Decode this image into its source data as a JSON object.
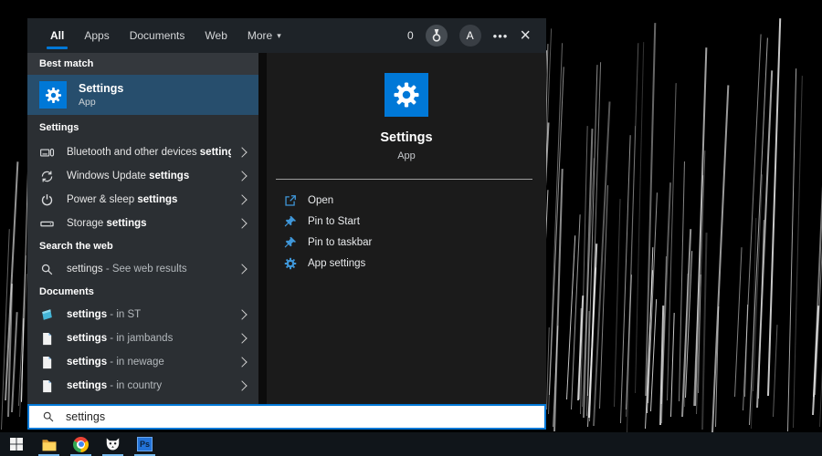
{
  "colors": {
    "accent": "#0078d7",
    "best_match_highlight": "#274e6d",
    "action_icon_blue": "#3f97d9"
  },
  "topbar": {
    "tabs": [
      {
        "label": "All",
        "active": true
      },
      {
        "label": "Apps",
        "active": false
      },
      {
        "label": "Documents",
        "active": false
      },
      {
        "label": "Web",
        "active": false
      },
      {
        "label": "More",
        "active": false,
        "has_dropdown": true
      }
    ],
    "icons": {
      "dropdown_arrow": "▾",
      "ellipsis": "•••",
      "close": "×"
    },
    "rewards_count": "0",
    "avatar_letter": "A"
  },
  "left_panel": {
    "best_match_header": "Best match",
    "best_match": {
      "title": "Settings",
      "subtitle": "App",
      "icon": "settings-gear-icon"
    },
    "settings_header": "Settings",
    "settings_items": [
      {
        "icon": "devices-icon",
        "prefix": "Bluetooth and other devices ",
        "bold": "settings"
      },
      {
        "icon": "update-icon",
        "prefix": "Windows Update ",
        "bold": "settings"
      },
      {
        "icon": "power-icon",
        "prefix": "Power & sleep ",
        "bold": "settings"
      },
      {
        "icon": "storage-icon",
        "prefix": "Storage ",
        "bold": "settings"
      }
    ],
    "web_header": "Search the web",
    "web_item": {
      "icon": "search-icon",
      "main": "settings",
      "suffix": " - See web results"
    },
    "documents_header": "Documents",
    "document_items": [
      {
        "icon": "note-icon",
        "bold": "settings",
        "suffix": " - in ST"
      },
      {
        "icon": "document-icon",
        "bold": "settings",
        "suffix": " - in jambands"
      },
      {
        "icon": "document-icon",
        "bold": "settings",
        "suffix": " - in newage"
      },
      {
        "icon": "document-icon",
        "bold": "settings",
        "suffix": " - in country"
      }
    ]
  },
  "right_panel": {
    "app_title": "Settings",
    "app_subtitle": "App",
    "app_icon": "settings-gear-icon",
    "actions": [
      {
        "icon": "open-icon",
        "label": "Open"
      },
      {
        "icon": "pin-icon",
        "label": "Pin to Start"
      },
      {
        "icon": "pin-icon",
        "label": "Pin to taskbar"
      },
      {
        "icon": "gear-icon",
        "label": "App settings"
      }
    ]
  },
  "search_box": {
    "value": "settings"
  },
  "taskbar": {
    "apps": [
      "start",
      "file-explorer",
      "chrome",
      "fox-browser",
      "photoshop"
    ],
    "photoshop_label": "Ps",
    "running_apps": [
      "file-explorer",
      "chrome",
      "fox-browser",
      "photoshop"
    ]
  }
}
